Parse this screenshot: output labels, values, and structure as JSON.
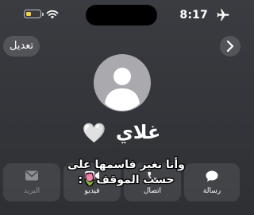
{
  "status_bar": {
    "time": "8:17",
    "icons": [
      "airplane-mode-icon",
      "wifi-icon",
      "battery-low-power-icon"
    ],
    "battery_color": "#f2d34a"
  },
  "nav": {
    "edit_label": "تعديل",
    "back_icon": "chevron-right-icon"
  },
  "contact": {
    "name": "غلاي",
    "name_emoji": "🤍",
    "avatar_icon": "person-silhouette-icon"
  },
  "actions": [
    {
      "label": "رسالة",
      "icon": "message-bubble-icon",
      "enabled": true
    },
    {
      "label": "اتصال",
      "icon": "phone-icon",
      "enabled": true
    },
    {
      "label": "فيديو",
      "icon": "video-icon",
      "enabled": true
    },
    {
      "label": "البريد",
      "icon": "mail-icon",
      "enabled": false
    }
  ],
  "caption": {
    "line1": "وأنا نغير فاسمها على",
    "line2": "حسب الموقف🌷:"
  }
}
